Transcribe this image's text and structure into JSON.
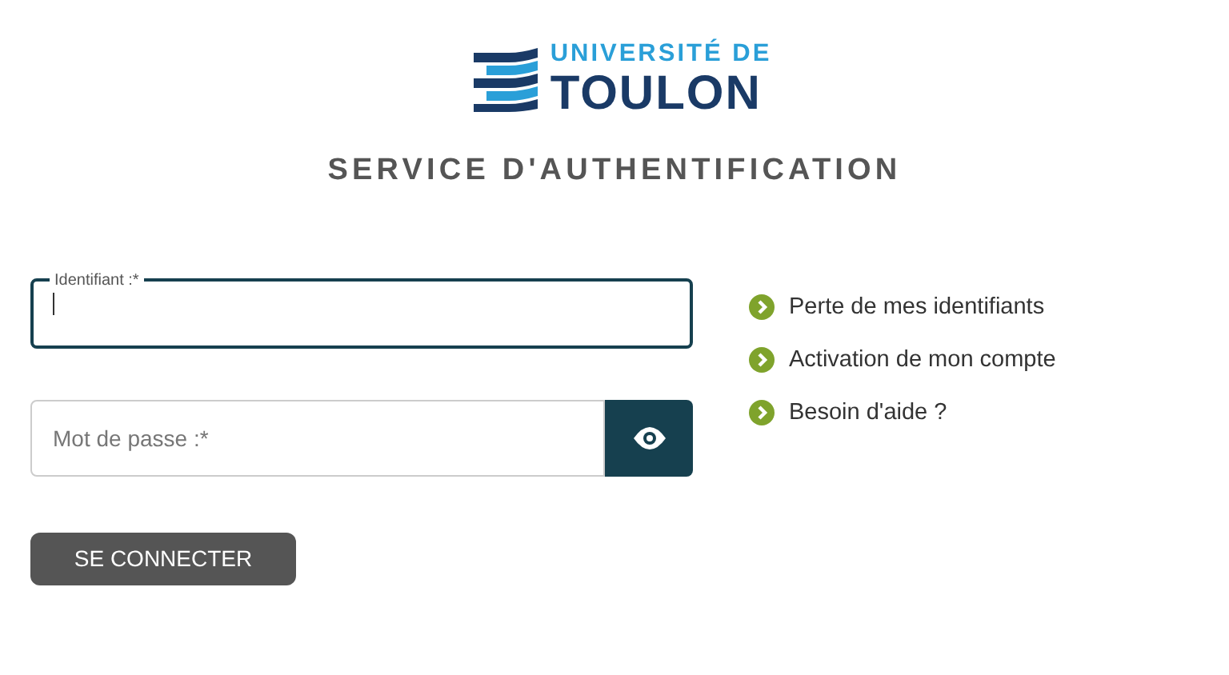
{
  "logo": {
    "line_1": "UNIVERSITÉ DE",
    "line_2": "TOULON"
  },
  "heading": "SERVICE D'AUTHENTIFICATION",
  "fields": [
    {
      "kind": "text",
      "label": "Identifiant :*",
      "focused": true
    },
    {
      "kind": "password",
      "placeholder": "Mot de passe :*",
      "focused": false
    }
  ],
  "submit": "SE CONNECTER",
  "links": [
    "Perte de mes identifiants",
    "Activation de mon compte",
    "Besoin d'aide ?"
  ]
}
